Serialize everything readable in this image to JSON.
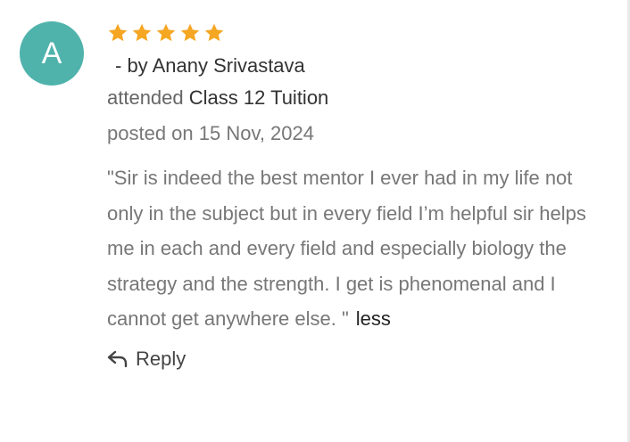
{
  "review": {
    "avatar_letter": "A",
    "avatar_color": "#4fb3ac",
    "rating": 5,
    "star_color": "#f5a623",
    "author_text": "- by Anany Srivastava",
    "attended_prefix": "attended",
    "class_name": "Class 12 Tuition",
    "posted_text": "posted on 15 Nov, 2024",
    "text": "\"Sir is indeed the best mentor I ever had in my life not only in the subject but in every field I’m helpful sir helps me in each and every field and especially biology the strategy and the strength. I get is phenomenal and I cannot get anywhere else. \"",
    "less_label": "less",
    "reply_label": "Reply",
    "reply_icon": "reply-arrow-icon"
  }
}
